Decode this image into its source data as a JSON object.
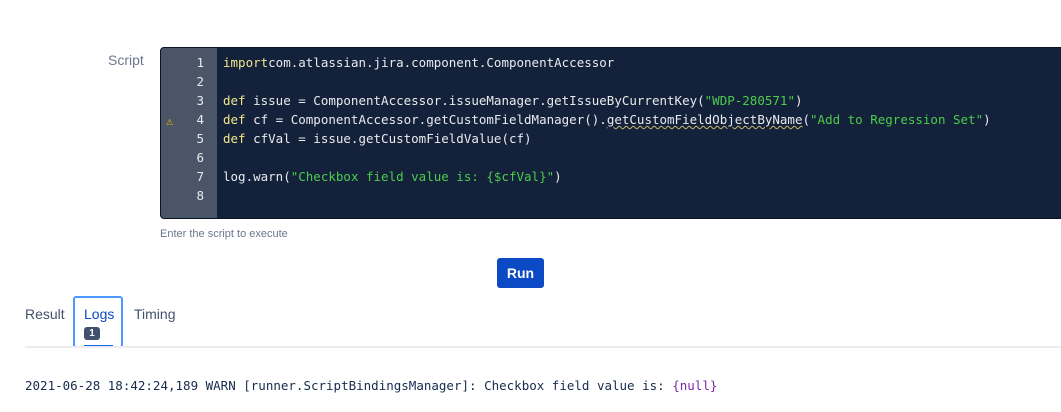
{
  "form": {
    "script_label": "Script",
    "hint": "Enter the script to execute",
    "run_label": "Run"
  },
  "editor": {
    "lines": [
      {
        "n": "1",
        "parts": [
          [
            "kw",
            "import"
          ],
          [
            "",
            "com.atlassian.jira.component.ComponentAccessor"
          ]
        ]
      },
      {
        "n": "2",
        "parts": []
      },
      {
        "n": "3",
        "parts": [
          [
            "kw",
            "def"
          ],
          [
            "",
            " issue = ComponentAccessor.issueManager.getIssueByCurrentKey("
          ],
          [
            "str",
            "\"WDP-280571\""
          ],
          [
            "",
            ")"
          ]
        ]
      },
      {
        "n": "4",
        "warning": true,
        "parts": [
          [
            "kw",
            "def"
          ],
          [
            "",
            " cf = ComponentAccessor.getCustomFieldManager()."
          ],
          [
            "squig",
            "getCustomFieldObjectByName"
          ],
          [
            "",
            "("
          ],
          [
            "str",
            "\"Add to Regression Set\""
          ],
          [
            "",
            ")"
          ]
        ]
      },
      {
        "n": "5",
        "parts": [
          [
            "kw",
            "def"
          ],
          [
            "",
            " cfVal = issue.getCustomFieldValue(cf)"
          ]
        ]
      },
      {
        "n": "6",
        "parts": []
      },
      {
        "n": "7",
        "parts": [
          [
            "",
            "log.warn("
          ],
          [
            "str",
            "\"Checkbox field value is: {$cfVal}\""
          ],
          [
            "",
            ")"
          ]
        ]
      },
      {
        "n": "8",
        "parts": []
      }
    ]
  },
  "tabs": {
    "result": "Result",
    "logs": "Logs",
    "logs_count": "1",
    "timing": "Timing"
  },
  "log": {
    "prefix": "2021-06-28 18:42:24,189 WARN [runner.ScriptBindingsManager]: Checkbox field value is: ",
    "value": "{null}"
  }
}
